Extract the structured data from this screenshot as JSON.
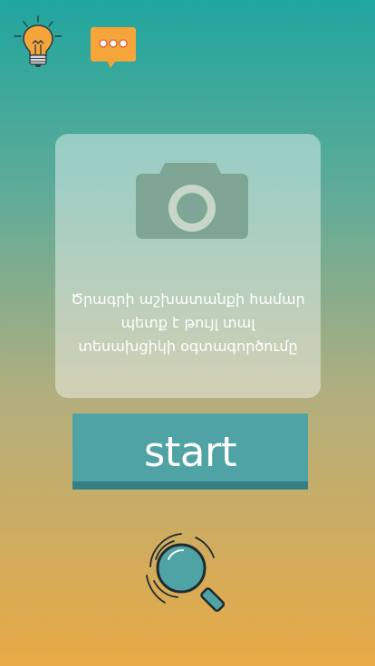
{
  "header": {
    "idea_icon": "lightbulb-icon",
    "messages_icon": "speech-bubble-icon"
  },
  "card": {
    "camera_icon": "camera-icon",
    "text_lines": [
      "Ծրագրի աշխատանքի համար",
      "պետք է թույլ տալ",
      "տեսախցիկի օգտագործումը"
    ]
  },
  "start_button": {
    "label": "start"
  },
  "search": {
    "icon": "magnifier-icon"
  },
  "colors": {
    "gradient_top": "#1fa69e",
    "gradient_bottom": "#e8aa45",
    "button_teal": "#4fa3a5",
    "button_shadow": "#347f84",
    "accent_orange": "#f6a53a",
    "camera_gray": "#7fa695"
  }
}
